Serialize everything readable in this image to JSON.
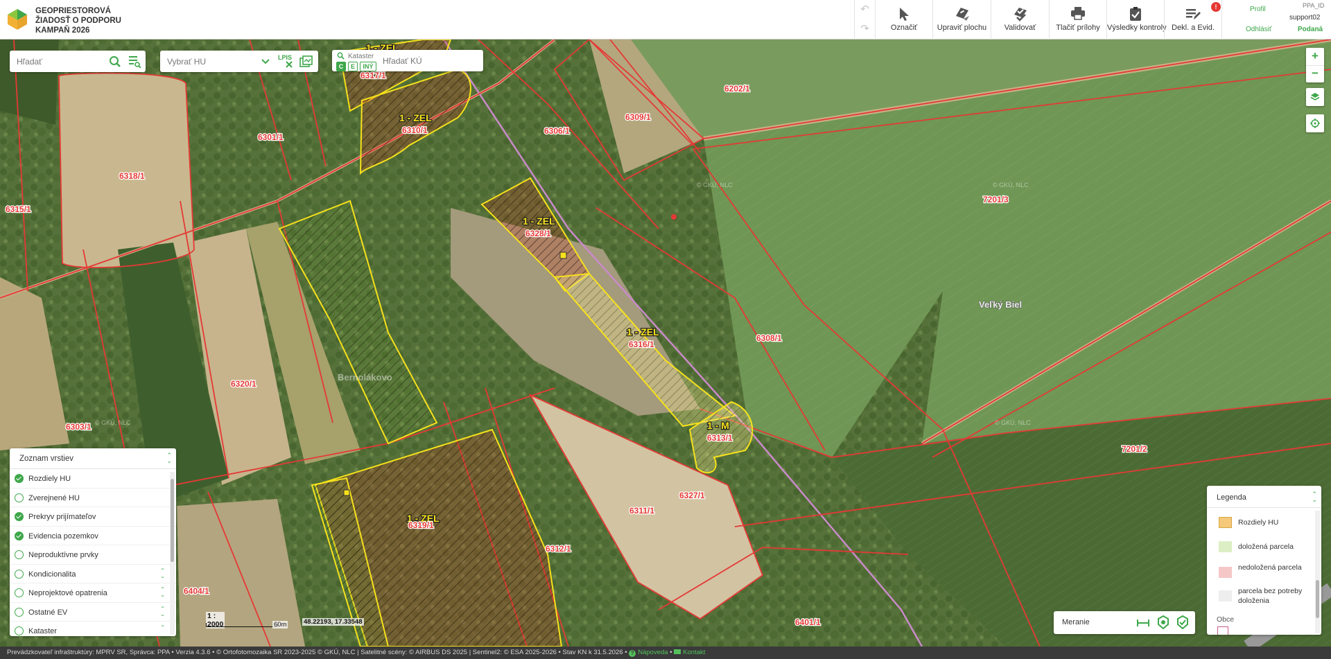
{
  "header": {
    "title_lines": [
      "GEOPRIESTOROVÁ",
      "ŽIADOSŤ O PODPORU",
      "KAMPAŇ 2026"
    ],
    "tools": [
      {
        "label": "Označiť",
        "icon": "cursor-icon"
      },
      {
        "label": "Upraviť plochu",
        "icon": "edit-area-icon"
      },
      {
        "label": "Validovať",
        "icon": "validate-icon"
      },
      {
        "label": "Tlačiť prílohy",
        "icon": "printer-icon"
      },
      {
        "label": "Výsledky kontroly",
        "icon": "clipboard-check-icon"
      },
      {
        "label": "Dekl. a Evid.",
        "icon": "declaration-icon",
        "badge": "!"
      }
    ],
    "user": {
      "profile_link": "Profil",
      "logout_link": "Odhlásiť",
      "id_label": "PPA_ID",
      "username": "support02",
      "status": "Podaná"
    }
  },
  "search": {
    "placeholder": "Hľadať",
    "hu_select_placeholder": "Vybrať HU",
    "lpis_label": "LPIS"
  },
  "kataster": {
    "label": "Kataster",
    "buttons": [
      "C",
      "E",
      "INÝ"
    ],
    "placeholder": "Hľadať KÚ"
  },
  "map": {
    "parcel_labels": [
      "6202/1",
      "6309/1",
      "6306/1",
      "6301/1",
      "6318/1",
      "6315/1",
      "7201/3",
      "6308/1",
      "6320/1",
      "6303/1",
      "7201/2",
      "6311/1",
      "6327/1",
      "6312/1",
      "6404/1",
      "6401/1"
    ],
    "zone_labels": [
      {
        "name": "1 - ZEL",
        "parcel": "6317/1"
      },
      {
        "name": "1 - ZEL",
        "parcel": "6310/1"
      },
      {
        "name": "1 - ZEL",
        "parcel": "6328/1"
      },
      {
        "name": "1 - ZEL",
        "parcel": "6316/1"
      },
      {
        "name": "1 - M",
        "parcel": "6313/1"
      },
      {
        "name": "1 - ZEL",
        "parcel": "6319/1"
      }
    ],
    "villages": [
      "Veľký Biel",
      "Bernolákovo"
    ],
    "watermark": "© GKÚ, NLC"
  },
  "layers": {
    "title": "Zoznam vrstiev",
    "items": [
      {
        "label": "Rozdiely HU",
        "checked": true,
        "expandable": false
      },
      {
        "label": "Zverejnené HU",
        "checked": false,
        "expandable": false
      },
      {
        "label": "Prekryv prijímateľov",
        "checked": true,
        "expandable": false
      },
      {
        "label": "Evidencia pozemkov",
        "checked": true,
        "expandable": false
      },
      {
        "label": "Neproduktívne prvky",
        "checked": false,
        "expandable": false
      },
      {
        "label": "Kondicionalita",
        "checked": false,
        "expandable": true
      },
      {
        "label": "Neprojektové opatrenia",
        "checked": false,
        "expandable": true
      },
      {
        "label": "Ostatné EV",
        "checked": false,
        "expandable": true
      },
      {
        "label": "Kataster",
        "checked": false,
        "expandable": true
      }
    ]
  },
  "scale": {
    "ratio": "1 : 2000",
    "unit": "60m"
  },
  "coordinates": "48.22193, 17.33548",
  "measure": {
    "label": "Meranie"
  },
  "legend": {
    "title": "Legenda",
    "items": [
      {
        "label": "Rozdiely HU",
        "color": "#f4c97a"
      },
      {
        "label": "doložená parcela",
        "color": "#dcefc4"
      },
      {
        "label": "nedoložená parcela",
        "color": "#f6c7c7"
      },
      {
        "label": "parcela bez potreby doloženia",
        "color": "#eeeeee"
      }
    ],
    "section": "Obce"
  },
  "footer": {
    "text": "Prevádzkovateľ infraštruktúry: MPRV SR, Správca: PPA • Verzia 4.3.6 • © Ortofotomozaika SR 2023-2025 © GKÚ, NLC | Satelitné scény: © AIRBUS DS 2025 | Sentinel2: © ESA 2025-2026 • Stav KN k 31.5.2026 •",
    "help_link": "Nápoveda",
    "contact_link": "Kontakt"
  },
  "colors": {
    "accent": "#3ea74a",
    "parcel_border": "#e53935",
    "zone_border": "#f7e21b"
  }
}
